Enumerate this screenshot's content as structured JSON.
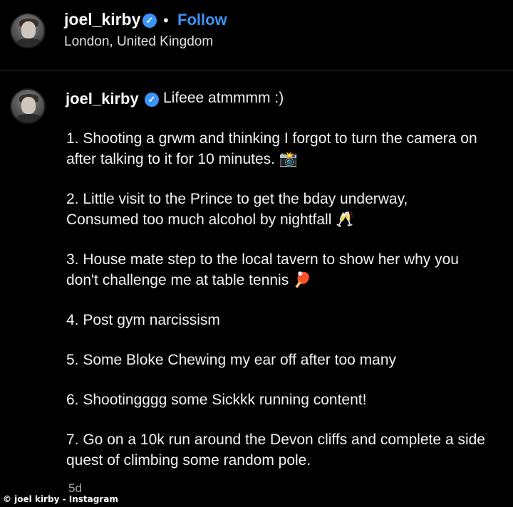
{
  "header": {
    "username": "joel_kirby",
    "verified_icon": "verified-badge-icon",
    "separator": "•",
    "follow_label": "Follow",
    "location": "London, United Kingdom"
  },
  "post": {
    "username": "joel_kirby",
    "caption_first": "Lifeee atmmmm :)",
    "items": [
      {
        "lines": [
          "1. Shooting a grwm and thinking I forgot to turn the camera on",
          "after talking to it for 10 minutes. 📸"
        ]
      },
      {
        "lines": [
          "2. Little visit to the Prince to get the bday underway,",
          "Consumed too much alcohol by nightfall 🥂"
        ]
      },
      {
        "lines": [
          "3. House mate step to the local tavern to show her why you",
          "don't challenge me at table tennis 🏓"
        ]
      },
      {
        "lines": [
          "4. Post gym narcissism"
        ]
      },
      {
        "lines": [
          "5. Some Bloke Chewing my ear off after too many"
        ]
      },
      {
        "lines": [
          "6. Shootingggg some Sickkk running content!"
        ]
      },
      {
        "lines": [
          "7. Go on a 10k run around the Devon cliffs and complete a side",
          "quest of climbing some random pole."
        ]
      }
    ],
    "timestamp": "5d"
  },
  "credit": "© joel kirby - Instagram",
  "colors": {
    "background": "#000000",
    "accent": "#3b94f7",
    "text": "#f2f2f2",
    "muted": "#a8a8a8"
  }
}
